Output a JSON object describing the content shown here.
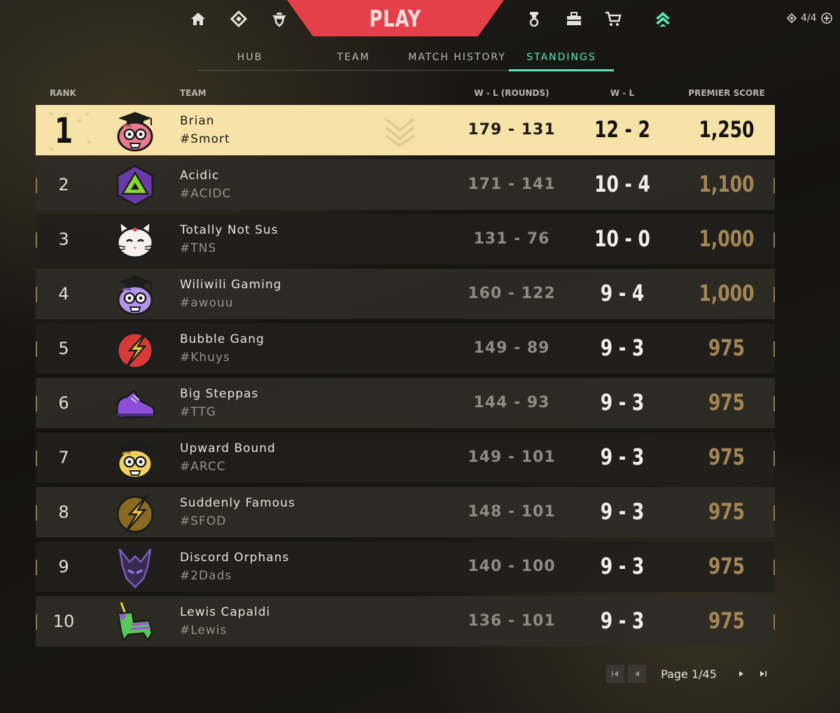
{
  "topnav": {
    "play_label": "PLAY",
    "counter": "4/4",
    "icons": [
      "home-icon",
      "career-icon",
      "agents-icon",
      "battlepass-icon",
      "collection-icon",
      "store-icon",
      "premier-icon"
    ]
  },
  "subtabs": [
    {
      "label": "HUB"
    },
    {
      "label": "TEAM"
    },
    {
      "label": "MATCH HISTORY"
    },
    {
      "label": "STANDINGS",
      "active": true
    }
  ],
  "table": {
    "headers": {
      "rank": "RANK",
      "team": "TEAM",
      "rounds": "W - L (ROUNDS)",
      "wl": "W - L",
      "score": "PREMIER SCORE"
    },
    "rows": [
      {
        "rank": "1",
        "name": "Brian",
        "tag": "#Smort",
        "rounds": "179 - 131",
        "wl": "12 - 2",
        "score": "1,250",
        "emblem": "pink-graduate-icon",
        "highlight": true
      },
      {
        "rank": "2",
        "name": "Acidic",
        "tag": "#ACIDC",
        "rounds": "171 - 141",
        "wl": "10 - 4",
        "score": "1,100",
        "emblem": "green-d20-icon"
      },
      {
        "rank": "3",
        "name": "Totally Not Sus",
        "tag": "#TNS",
        "rounds": "131 - 76",
        "wl": "10 - 0",
        "score": "1,000",
        "emblem": "white-cat-icon"
      },
      {
        "rank": "4",
        "name": "Wiliwili Gaming",
        "tag": "#awouu",
        "rounds": "160 - 122",
        "wl": "9 - 4",
        "score": "1,000",
        "emblem": "purple-graduate-icon"
      },
      {
        "rank": "5",
        "name": "Bubble Gang",
        "tag": "#Khuys",
        "rounds": "149 - 89",
        "wl": "9 - 3",
        "score": "975",
        "emblem": "red-lightning-icon"
      },
      {
        "rank": "6",
        "name": "Big Steppas",
        "tag": "#TTG",
        "rounds": "144 - 93",
        "wl": "9 - 3",
        "score": "975",
        "emblem": "purple-sneaker-icon"
      },
      {
        "rank": "7",
        "name": "Upward Bound",
        "tag": "#ARCC",
        "rounds": "149 - 101",
        "wl": "9 - 3",
        "score": "975",
        "emblem": "yellow-graduate-icon"
      },
      {
        "rank": "8",
        "name": "Suddenly Famous",
        "tag": "#SFOD",
        "rounds": "148 - 101",
        "wl": "9 - 3",
        "score": "975",
        "emblem": "gold-lightning-icon"
      },
      {
        "rank": "9",
        "name": "Discord Orphans",
        "tag": "#2Dads",
        "rounds": "140 - 100",
        "wl": "9 - 3",
        "score": "975",
        "emblem": "purple-dragon-icon"
      },
      {
        "rank": "10",
        "name": "Lewis Capaldi",
        "tag": "#Lewis",
        "rounds": "136 - 101",
        "wl": "9 - 3",
        "score": "975",
        "emblem": "green-pinata-icon"
      }
    ]
  },
  "pagination": {
    "label": "Page 1/45"
  },
  "colors": {
    "accent_red": "#e5404a",
    "accent_teal": "#5ee6bf",
    "highlight_row": "#f7e2a8",
    "score_gold": "#a48654"
  }
}
